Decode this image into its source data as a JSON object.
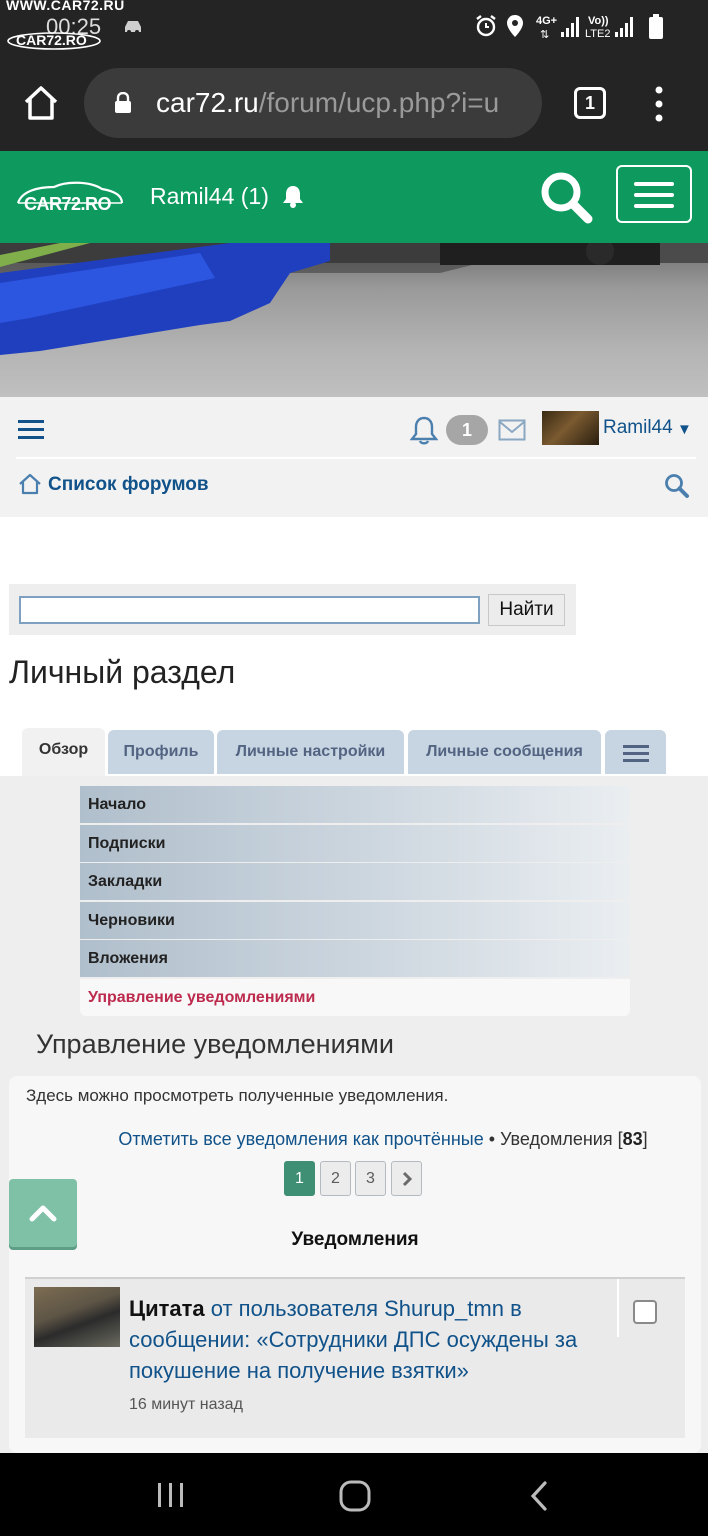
{
  "status_bar": {
    "watermark": "WWW.CAR72.RU",
    "time": "00:25",
    "watermark_logo": "CAR72.RO",
    "network_4g": "4G+",
    "volte": "Vo))",
    "lte": "LTE2",
    "icons": [
      "car-icon",
      "alarm-icon",
      "location-icon",
      "signal-icon",
      "battery-icon"
    ]
  },
  "browser": {
    "url_host": "car72.ru",
    "url_path": "/forum/ucp.php?i=u",
    "tab_count": "1"
  },
  "site_header": {
    "logo_text": "CAR72.RO",
    "user_notifications": "Ramil44 (1)",
    "brand_color": "#0e9a5f"
  },
  "forum_nav": {
    "notification_count": "1",
    "username": "Ramil44",
    "forum_list": "Список форумов"
  },
  "search": {
    "value": "",
    "button": "Найти"
  },
  "page_title": "Личный раздел",
  "tabs": [
    {
      "label": "Обзор",
      "active": true
    },
    {
      "label": "Профиль"
    },
    {
      "label": "Личные настройки"
    },
    {
      "label": "Личные сообщения"
    }
  ],
  "subnav": [
    {
      "label": "Начало"
    },
    {
      "label": "Подписки"
    },
    {
      "label": "Закладки"
    },
    {
      "label": "Черновики"
    },
    {
      "label": "Вложения"
    },
    {
      "label": "Управление уведомлениями",
      "active": true
    }
  ],
  "section": {
    "title": "Управление уведомлениями",
    "description": "Здесь можно просмотреть полученные уведомления.",
    "mark_all": "Отметить все уведомления как прочтённые",
    "bullet": " • Уведомления [",
    "count": "83",
    "close_bracket": "]",
    "pages": [
      "1",
      "2",
      "3"
    ],
    "current_page": "1",
    "list_header": "Уведомления"
  },
  "notification": {
    "type": "Цитата",
    "text": " от пользователя Shurup_tmn в сообщении: «Сотрудники ДПС осуждены за покушение на получение взятки»",
    "time": "16 минут назад"
  }
}
